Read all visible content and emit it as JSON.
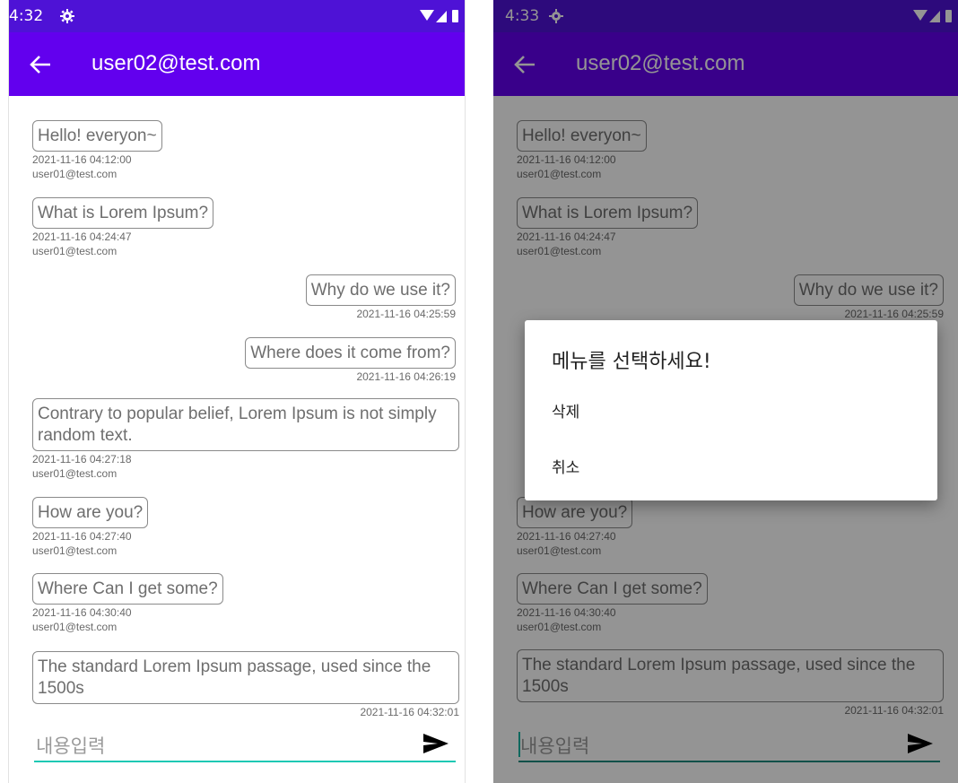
{
  "screens": [
    {
      "status": {
        "time": "4:32"
      },
      "app_bar": {
        "title": "user02@test.com"
      },
      "messages": [
        {
          "text": "Hello! everyon~",
          "time": "2021-11-16 04:12:00",
          "sender": "user01@test.com",
          "side": "left"
        },
        {
          "text": "What is Lorem Ipsum?",
          "time": "2021-11-16 04:24:47",
          "sender": "user01@test.com",
          "side": "left"
        },
        {
          "text": "Why do we use it?",
          "time": "2021-11-16 04:25:59",
          "side": "right"
        },
        {
          "text": "Where does it come from?",
          "time": "2021-11-16 04:26:19",
          "side": "right"
        },
        {
          "text": "Contrary to popular belief, Lorem Ipsum is not simply random text.",
          "time": "2021-11-16 04:27:18",
          "sender": "user01@test.com",
          "side": "left"
        },
        {
          "text": "How are you?",
          "time": "2021-11-16 04:27:40",
          "sender": "user01@test.com",
          "side": "left"
        },
        {
          "text": "Where Can I get some?",
          "time": "2021-11-16 04:30:40",
          "sender": "user01@test.com",
          "side": "left"
        },
        {
          "text": "The standard Lorem Ipsum passage, used since the 1500s",
          "time": "2021-11-16 04:32:01",
          "side": "right"
        }
      ],
      "input": {
        "placeholder": "내용입력"
      }
    },
    {
      "status": {
        "time": "4:33"
      },
      "app_bar": {
        "title": "user02@test.com"
      },
      "messages": [
        {
          "text": "Hello! everyon~",
          "time": "2021-11-16 04:12:00",
          "sender": "user01@test.com",
          "side": "left"
        },
        {
          "text": "What is Lorem Ipsum?",
          "time": "2021-11-16 04:24:47",
          "sender": "user01@test.com",
          "side": "left"
        },
        {
          "text": "Why do we use it?",
          "time": "2021-11-16 04:25:59",
          "side": "right"
        },
        {
          "text": "How are you?",
          "time": "2021-11-16 04:27:40",
          "sender": "user01@test.com",
          "side": "left"
        },
        {
          "text": "Where Can I get some?",
          "time": "2021-11-16 04:30:40",
          "sender": "user01@test.com",
          "side": "left"
        },
        {
          "text": "The standard Lorem Ipsum passage, used since the 1500s",
          "time": "2021-11-16 04:32:01",
          "side": "right"
        }
      ],
      "dialog": {
        "title": "메뉴를 선택하세요!",
        "items": [
          "삭제",
          "취소"
        ]
      },
      "input": {
        "placeholder": "내용입력"
      }
    }
  ],
  "colors": {
    "status_bar": "#4e12d6",
    "app_bar": "#6200ee",
    "input_underline": "#1ec8b4"
  },
  "icons": [
    "gear-icon",
    "wifi-icon",
    "signal-icon",
    "battery-icon",
    "arrow-back-icon",
    "send-icon"
  ]
}
